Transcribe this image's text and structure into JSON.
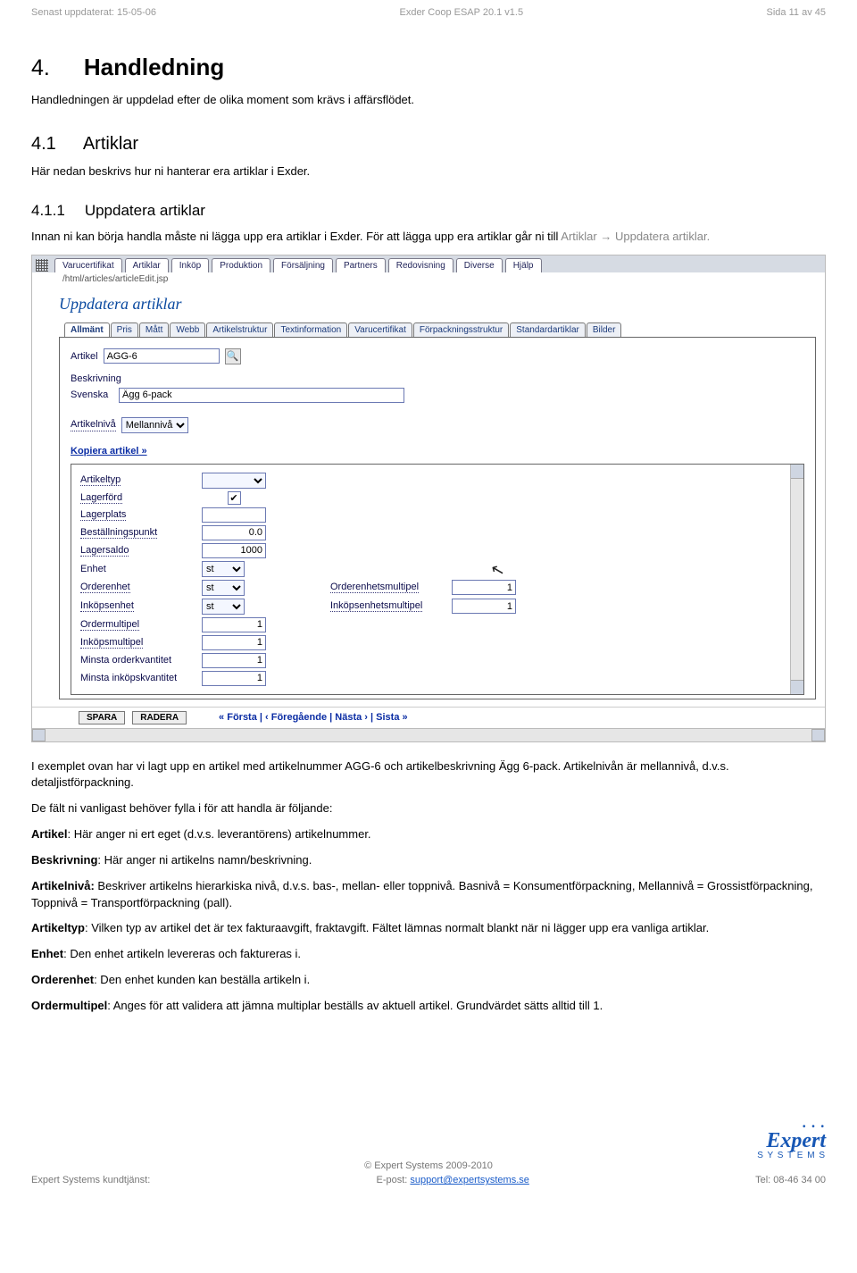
{
  "meta": {
    "updated": "Senast uppdaterat: 15-05-06",
    "center": "Exder Coop ESAP 20.1 v1.5",
    "page": "Sida 11 av 45"
  },
  "h1": {
    "num": "4.",
    "title": "Handledning"
  },
  "h1_intro": "Handledningen är uppdelad efter de olika moment som krävs i affärsflödet.",
  "h2": {
    "num": "4.1",
    "title": "Artiklar"
  },
  "h2_intro": "Här nedan beskrivs hur ni hanterar era artiklar i Exder.",
  "h3": {
    "num": "4.1.1",
    "title": "Uppdatera artiklar"
  },
  "h3_p_a": "Innan ni kan börja handla måste ni lägga upp era artiklar i Exder. För att lägga upp era artiklar går ni till ",
  "h3_p_b": "Artiklar → Uppdatera artiklar.",
  "ui": {
    "menu": [
      "Varucertifikat",
      "Artiklar",
      "Inköp",
      "Produktion",
      "Försäljning",
      "Partners",
      "Redovisning",
      "Diverse",
      "Hjälp"
    ],
    "path": "/html/articles/articleEdit.jsp",
    "title": "Uppdatera artiklar",
    "tabs": [
      "Allmänt",
      "Pris",
      "Mått",
      "Webb",
      "Artikelstruktur",
      "Textinformation",
      "Varucertifikat",
      "Förpackningsstruktur",
      "Standardartiklar",
      "Bilder"
    ],
    "active_tab": 0,
    "form": {
      "artikel_label": "Artikel",
      "artikel_value": "AGG-6",
      "beskrivning_label": "Beskrivning",
      "svenska_label": "Svenska",
      "svenska_value": "Ägg 6-pack",
      "nivalabel": "Artikelnivå",
      "nivavalue": "Mellannivå",
      "kopiera": "Kopiera artikel »"
    },
    "grid": {
      "artikeltyp": "Artikeltyp",
      "lagerford": "Lagerförd",
      "lagerplats": "Lagerplats",
      "bestallningspunkt": "Beställningspunkt",
      "bestallningspunkt_val": "0.0",
      "lagersaldo": "Lagersaldo",
      "lagersaldo_val": "1000",
      "enhet": "Enhet",
      "enhet_val": "st",
      "orderenhet": "Orderenhet",
      "orderenhet_val": "st",
      "orderenhetsmultipel": "Orderenhetsmultipel",
      "orderenhetsmultipel_val": "1",
      "inkopsenhet": "Inköpsenhet",
      "inkopsenhet_val": "st",
      "inkopsenhetsmultipel": "Inköpsenhetsmultipel",
      "inkopsenhetsmultipel_val": "1",
      "ordermultipel": "Ordermultipel",
      "ordermultipel_val": "1",
      "inkopsmultipel": "Inköpsmultipel",
      "inkopsmultipel_val": "1",
      "minsta_orderkv": "Minsta orderkvantitet",
      "minsta_orderkv_val": "1",
      "minsta_inkopskv": "Minsta inköpskvantitet",
      "minsta_inkopskv_val": "1"
    },
    "footer": {
      "spara": "SPARA",
      "radera": "RADERA",
      "pager": "« Första | ‹ Föregående | Nästa › | Sista »"
    }
  },
  "body": {
    "p1": "I exemplet ovan har vi lagt upp en artikel med artikelnummer AGG-6 och artikelbeskrivning Ägg 6-pack. Artikelnivån är mellannivå, d.v.s. detaljistförpackning.",
    "p2": "De fält ni vanligast behöver fylla i för att handla är följande:",
    "artikel_b": "Artikel",
    "artikel_t": ": Här anger ni ert eget (d.v.s. leverantörens) artikelnummer.",
    "beskrivning_b": "Beskrivning",
    "beskrivning_t": ": Här anger ni artikelns namn/beskrivning.",
    "artikelniva_b": "Artikelnivå:",
    "artikelniva_t": " Beskriver artikelns hierarkiska nivå, d.v.s. bas-, mellan- eller toppnivå. Basnivå = Konsumentförpackning, Mellannivå = Grossistförpackning, Toppnivå = Transportförpackning (pall).",
    "artikeltyp_b": "Artikeltyp",
    "artikeltyp_t": ": Vilken typ av artikel det är tex fakturaavgift, fraktavgift. Fältet lämnas normalt blankt när ni lägger upp era vanliga artiklar.",
    "enhet_b": "Enhet",
    "enhet_t": ": Den enhet artikeln levereras och faktureras i.",
    "orderenhet_b": "Orderenhet",
    "orderenhet_t": ": Den enhet kunden kan beställa artikeln i.",
    "ordermultipel_b": "Ordermultipel",
    "ordermultipel_t": ": Anges för att validera att jämna multiplar beställs av aktuell artikel. Grundvärdet sätts alltid till 1."
  },
  "footer": {
    "copyright": "© Expert Systems 2009-2010",
    "left": "Expert Systems kundtjänst:",
    "mid_pre": "E-post: ",
    "mid_link": "support@expertsystems.se",
    "right": "Tel: 08-46 34 00",
    "logo_main": "Expert",
    "logo_sub": "S Y S T E M S"
  }
}
